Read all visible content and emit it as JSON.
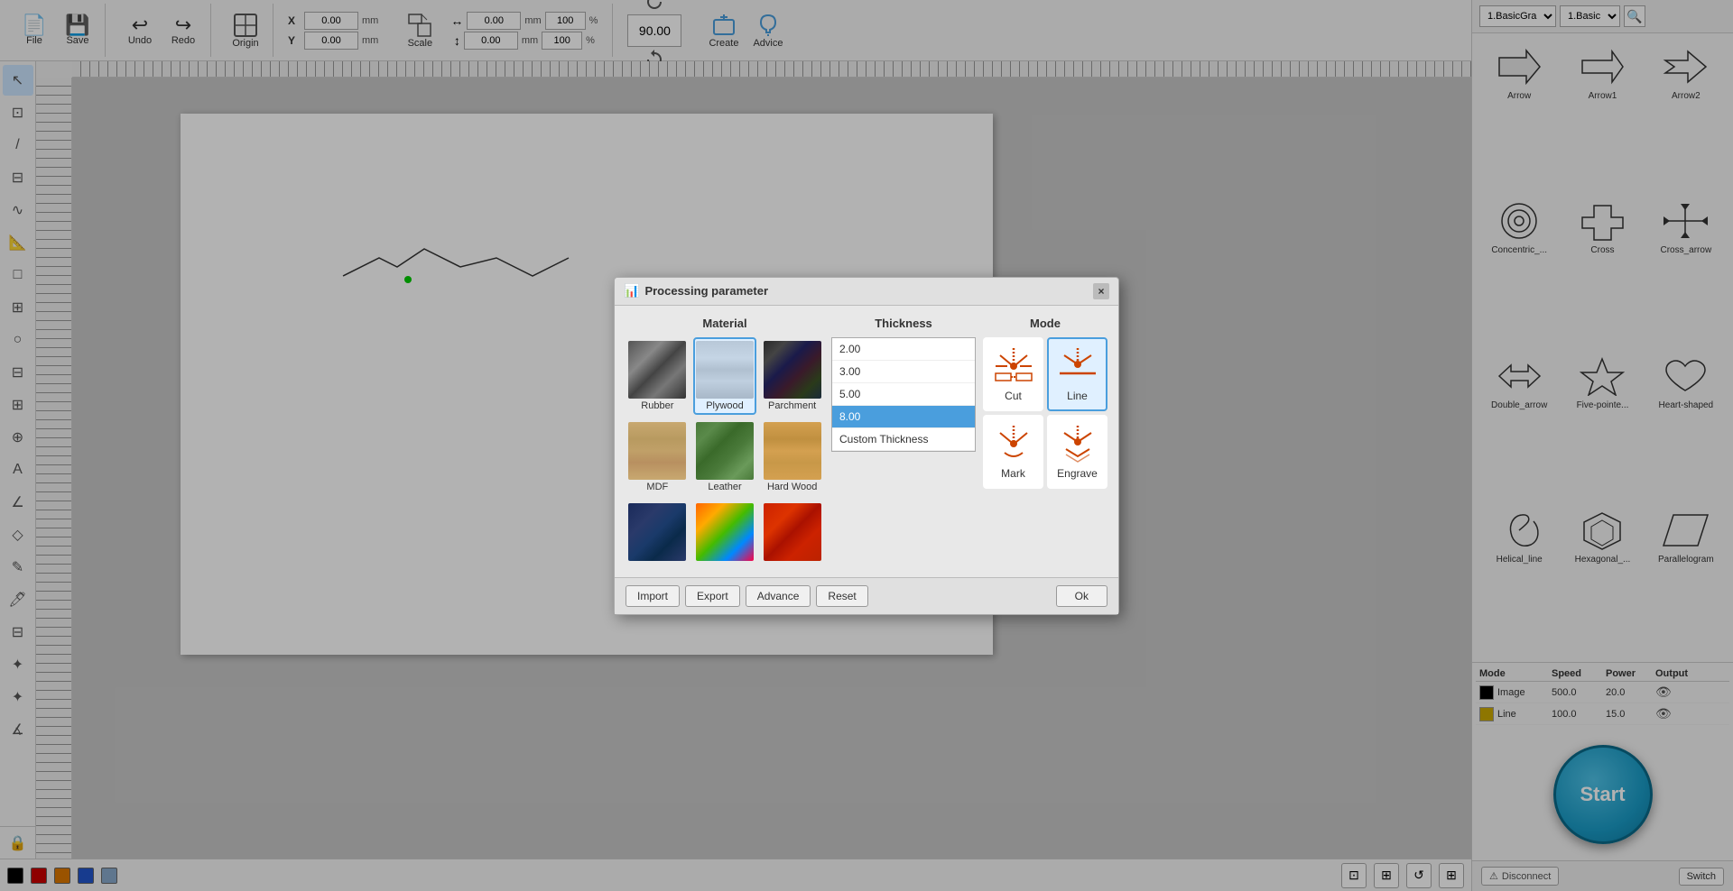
{
  "toolbar": {
    "file_label": "File",
    "save_label": "Save",
    "undo_label": "Undo",
    "redo_label": "Redo",
    "origin_label": "Origin",
    "scale_label": "Scale",
    "create_label": "Create",
    "advice_label": "Advice",
    "x_label": "X",
    "y_label": "Y",
    "x_value": "0.00",
    "y_value": "0.00",
    "w_value": "0.00",
    "h_value": "0.00",
    "w_pct": "100",
    "h_pct": "100",
    "rotate_value": "90.00",
    "mm_label": "mm",
    "pct_label": "%"
  },
  "right_panel": {
    "dropdown1": "1.BasicGra",
    "dropdown2": "1.Basic",
    "shapes": [
      {
        "label": "Arrow",
        "id": "arrow"
      },
      {
        "label": "Arrow1",
        "id": "arrow1"
      },
      {
        "label": "Arrow2",
        "id": "arrow2"
      },
      {
        "label": "Concentric_...",
        "id": "concentric"
      },
      {
        "label": "Cross",
        "id": "cross"
      },
      {
        "label": "Cross_arrow",
        "id": "cross-arrow"
      },
      {
        "label": "Double_arrow",
        "id": "double-arrow"
      },
      {
        "label": "Five-pointe...",
        "id": "five-pointed"
      },
      {
        "label": "Heart-shaped",
        "id": "heart"
      },
      {
        "label": "Helical_line",
        "id": "helical"
      },
      {
        "label": "Hexagonal_...",
        "id": "hexagonal"
      },
      {
        "label": "Parallelogram",
        "id": "parallelogram"
      }
    ],
    "layers_header": [
      "Mode",
      "Speed",
      "Power",
      "Output"
    ],
    "layers": [
      {
        "mode": "Image",
        "speed": "500.0",
        "power": "20.0",
        "color": "#000000"
      },
      {
        "mode": "Line",
        "speed": "100.0",
        "power": "15.0",
        "color": "#ccaa00"
      }
    ],
    "start_label": "Start",
    "disconnect_label": "Disconnect",
    "switch_label": "Switch"
  },
  "modal": {
    "title": "Processing parameter",
    "close_label": "×",
    "material_title": "Material",
    "thickness_title": "Thickness",
    "mode_title": "Mode",
    "materials": [
      {
        "id": "rubber",
        "label": "Rubber",
        "selected": false
      },
      {
        "id": "plywood",
        "label": "Plywood",
        "selected": true
      },
      {
        "id": "parchment",
        "label": "Parchment",
        "selected": false
      },
      {
        "id": "mdf",
        "label": "MDF",
        "selected": false
      },
      {
        "id": "leather",
        "label": "Leather",
        "selected": false
      },
      {
        "id": "hardwood",
        "label": "Hard Wood",
        "selected": false
      },
      {
        "id": "fabric1",
        "label": "",
        "selected": false
      },
      {
        "id": "fabric2",
        "label": "",
        "selected": false
      },
      {
        "id": "fabric3",
        "label": "",
        "selected": false
      }
    ],
    "thicknesses": [
      {
        "value": "2.00",
        "selected": false
      },
      {
        "value": "3.00",
        "selected": false
      },
      {
        "value": "5.00",
        "selected": false
      },
      {
        "value": "8.00",
        "selected": true
      },
      {
        "value": "Custom Thickness",
        "selected": false
      }
    ],
    "modes": [
      {
        "id": "cut",
        "label": "Cut",
        "selected": false
      },
      {
        "id": "line",
        "label": "Line",
        "selected": true
      },
      {
        "id": "mark",
        "label": "Mark",
        "selected": false
      },
      {
        "id": "engrave",
        "label": "Engrave",
        "selected": false
      }
    ],
    "buttons": {
      "import": "Import",
      "export": "Export",
      "advance": "Advance",
      "reset": "Reset",
      "ok": "Ok"
    }
  },
  "bottom_colors": [
    "#000000",
    "#cc0000",
    "#dd7700",
    "#2255cc",
    "#88aacc"
  ],
  "bottom_tools": [
    "grid",
    "fit",
    "refresh",
    "table"
  ]
}
